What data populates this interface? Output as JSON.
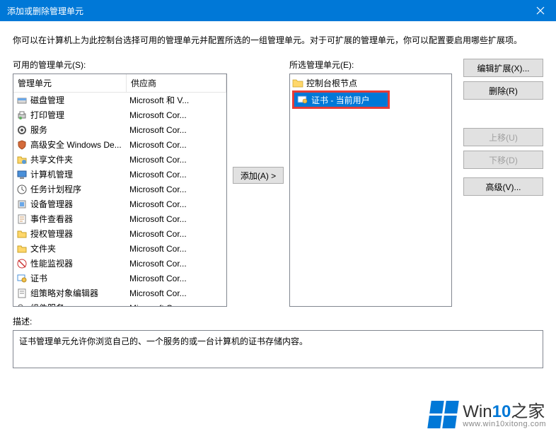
{
  "titlebar": {
    "title": "添加或删除管理单元"
  },
  "desc_top": "你可以在计算机上为此控制台选择可用的管理单元并配置所选的一组管理单元。对于可扩展的管理单元，你可以配置要启用哪些扩展项。",
  "available": {
    "label": "可用的管理单元(S):",
    "headers": {
      "name": "管理单元",
      "vendor": "供应商"
    },
    "items": [
      {
        "icon": "disk",
        "name": "磁盘管理",
        "vendor": "Microsoft 和 V..."
      },
      {
        "icon": "print",
        "name": "打印管理",
        "vendor": "Microsoft Cor..."
      },
      {
        "icon": "gear",
        "name": "服务",
        "vendor": "Microsoft Cor..."
      },
      {
        "icon": "shield",
        "name": "高级安全 Windows De...",
        "vendor": "Microsoft Cor..."
      },
      {
        "icon": "folder-share",
        "name": "共享文件夹",
        "vendor": "Microsoft Cor..."
      },
      {
        "icon": "computer",
        "name": "计算机管理",
        "vendor": "Microsoft Cor..."
      },
      {
        "icon": "clock",
        "name": "任务计划程序",
        "vendor": "Microsoft Cor..."
      },
      {
        "icon": "device",
        "name": "设备管理器",
        "vendor": "Microsoft Cor..."
      },
      {
        "icon": "event",
        "name": "事件查看器",
        "vendor": "Microsoft Cor..."
      },
      {
        "icon": "auth",
        "name": "授权管理器",
        "vendor": "Microsoft Cor..."
      },
      {
        "icon": "folder",
        "name": "文件夹",
        "vendor": "Microsoft Cor..."
      },
      {
        "icon": "perf",
        "name": "性能监视器",
        "vendor": "Microsoft Cor..."
      },
      {
        "icon": "cert",
        "name": "证书",
        "vendor": "Microsoft Cor..."
      },
      {
        "icon": "policy",
        "name": "组策略对象编辑器",
        "vendor": "Microsoft Cor..."
      },
      {
        "icon": "comp-svc",
        "name": "组件服务",
        "vendor": "Microsoft Cor..."
      }
    ]
  },
  "add_button": "添加(A) >",
  "selected": {
    "label": "所选管理单元(E):",
    "root": "控制台根节点",
    "child": "证书 - 当前用户"
  },
  "buttons": {
    "edit_ext": "编辑扩展(X)...",
    "remove": "删除(R)",
    "move_up": "上移(U)",
    "move_down": "下移(D)",
    "advanced": "高级(V)..."
  },
  "description": {
    "label": "描述:",
    "text": "证书管理单元允许你浏览自己的、一个服务的或一台计算机的证书存储内容。"
  },
  "watermark": {
    "brand_prefix": "Win",
    "brand_accent": "10",
    "brand_suffix": "之家",
    "url": "www.win10xitong.com"
  }
}
